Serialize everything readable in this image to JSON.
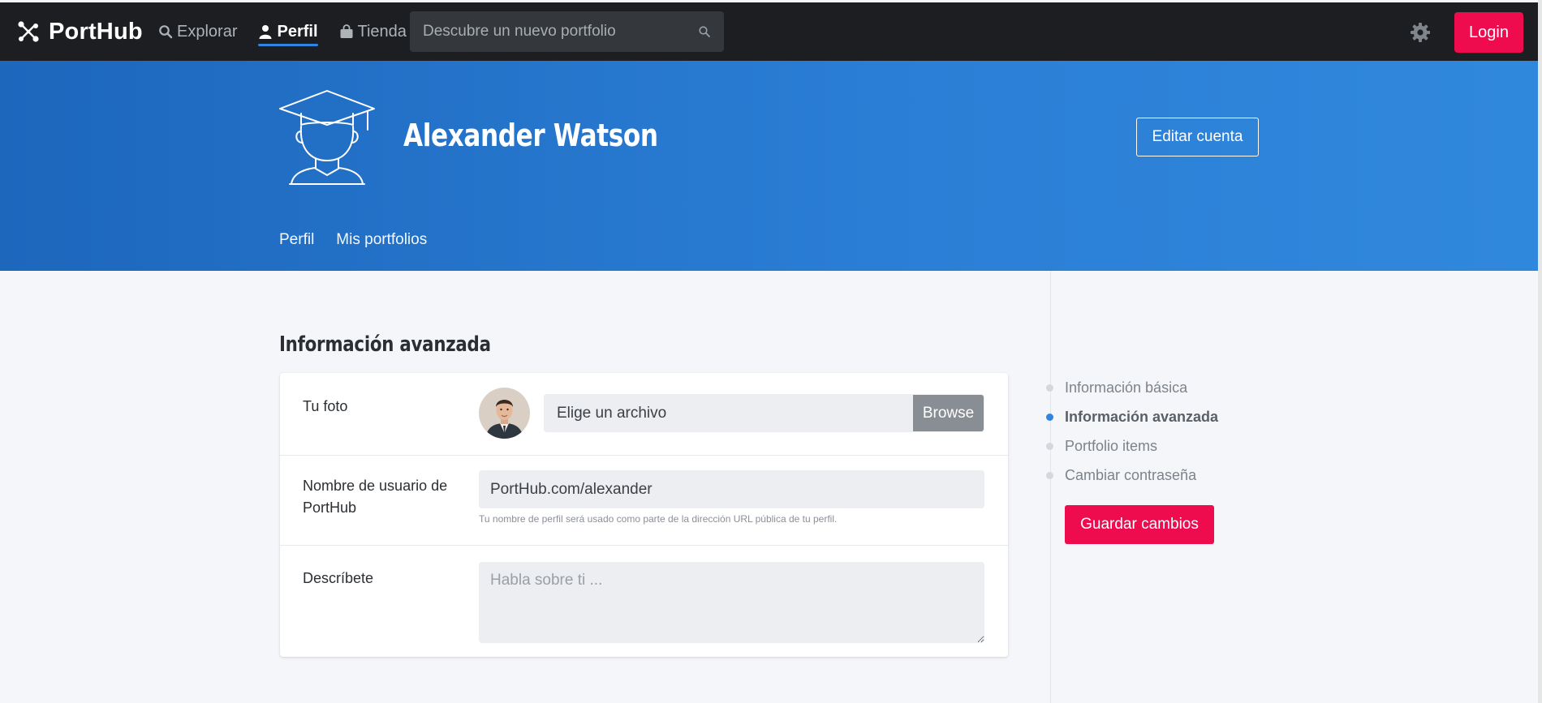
{
  "brand": {
    "name": "PortHub"
  },
  "nav": {
    "items": [
      {
        "label": "Explorar",
        "icon": "search-icon",
        "active": false
      },
      {
        "label": "Perfil",
        "icon": "user-icon",
        "active": true
      },
      {
        "label": "Tienda",
        "icon": "shopping-bag-icon",
        "active": false
      }
    ],
    "search_placeholder": "Descubre un nuevo portfolio",
    "login_label": "Login"
  },
  "profile": {
    "name": "Alexander Watson",
    "edit_label": "Editar cuenta",
    "tabs": [
      {
        "label": "Perfil"
      },
      {
        "label": "Mis portfolios"
      }
    ]
  },
  "section": {
    "title": "Información avanzada",
    "photo_label": "Tu foto",
    "file_placeholder": "Elige un archivo",
    "browse_label": "Browse",
    "username_label": "Nombre de usuario de PortHub",
    "username_value": "PortHub.com/alexander",
    "username_help": "Tu nombre de perfil será usado como parte de la dirección URL pública de tu perfil.",
    "describe_label": "Descríbete",
    "describe_placeholder": "Habla sobre ti ..."
  },
  "toc": {
    "items": [
      {
        "label": "Información básica",
        "active": false
      },
      {
        "label": "Información avanzada",
        "active": true
      },
      {
        "label": "Portfolio items",
        "active": false
      },
      {
        "label": "Cambiar contraseña",
        "active": false
      }
    ],
    "save_label": "Guardar cambios"
  },
  "colors": {
    "accent": "#ee0c4f",
    "primary": "#2b7fd6",
    "topbar": "#1c1e21"
  }
}
